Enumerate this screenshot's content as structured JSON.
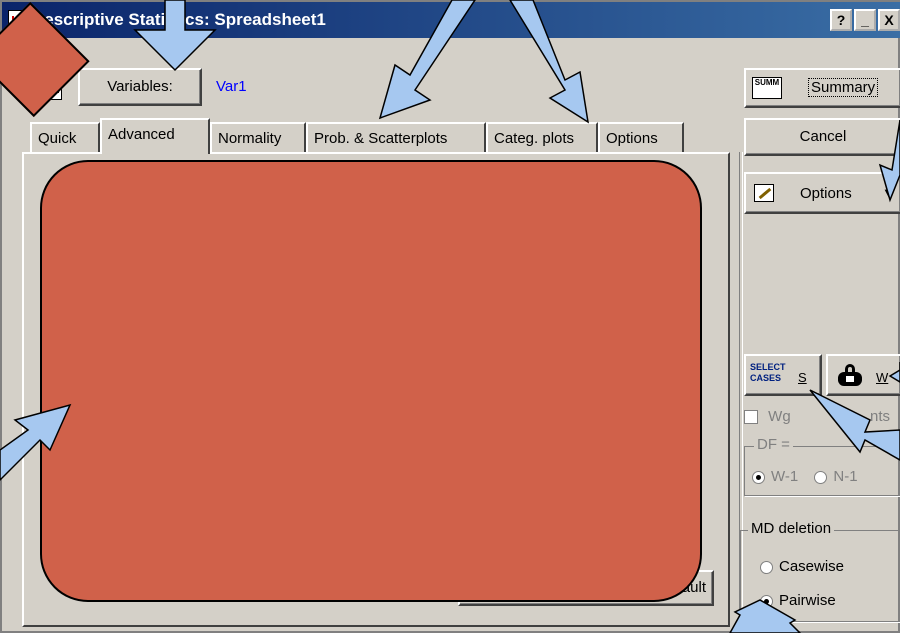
{
  "window": {
    "title": "Descriptive Statistics: Spreadsheet1"
  },
  "titlebar_buttons": [
    "?",
    "_",
    "X"
  ],
  "variables": {
    "button_label": "Variables:",
    "value": "Var1"
  },
  "tabs": [
    "Quick",
    "Advanced",
    "Normality",
    "Prob. & Scatterplots",
    "Categ. plots",
    "Options"
  ],
  "active_tab": "Advanced",
  "right": {
    "summary_label": "Summary",
    "summary_icon_text": "SUMM",
    "cancel_label": "Cancel",
    "options_label": "Options",
    "select_cases_icon_text": "SELECT CASES",
    "select_cases_label": "S",
    "weight_label": "W",
    "weights_partial_1": "Wg",
    "weights_partial_2": "nts",
    "df_legend": "DF =",
    "df_w1": "W-1",
    "df_n1": "N-1",
    "md_legend": "MD deletion",
    "casewise": "Casewise",
    "pairwise": "Pairwise"
  },
  "panel": {
    "default_partial": "fault"
  },
  "colors": {
    "overlay": "#d0614a",
    "arrow": "#a6c8f0",
    "title_start": "#0a246a",
    "var_text": "#0000ff"
  }
}
